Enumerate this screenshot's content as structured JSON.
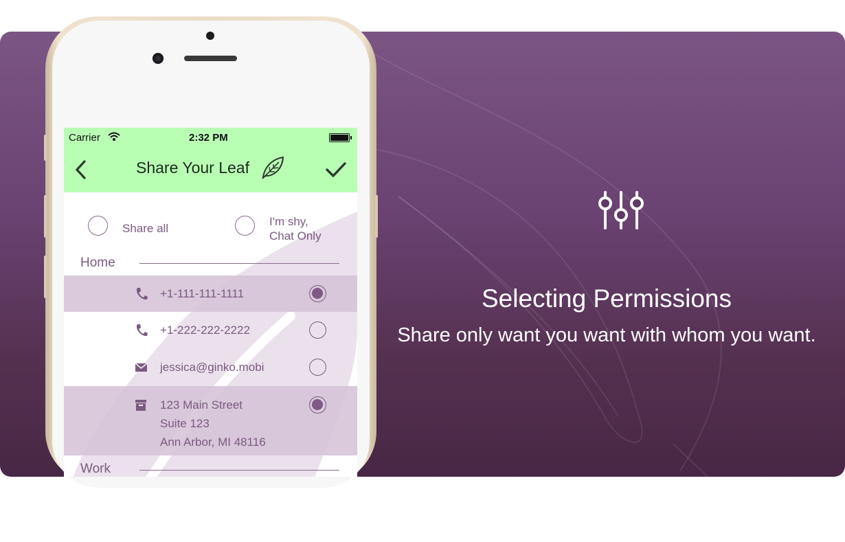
{
  "status_bar": {
    "carrier": "Carrier",
    "time": "2:32 PM"
  },
  "nav": {
    "title": "Share Your Leaf"
  },
  "options": {
    "share_all": "Share all",
    "shy_line1": "I'm shy,",
    "shy_line2": "Chat Only"
  },
  "sections": {
    "home": "Home",
    "work": "Work"
  },
  "contacts": [
    {
      "icon": "phone-icon",
      "text": "+1-111-111-1111",
      "selected": true
    },
    {
      "icon": "phone-icon",
      "text": "+1-222-222-2222",
      "selected": false
    },
    {
      "icon": "email-icon",
      "text": "jessica@ginko.mobi",
      "selected": false
    },
    {
      "icon": "address-icon",
      "line1": "123 Main Street",
      "line2": "Suite 123",
      "line3": "Ann Arbor, MI 48116",
      "selected": true
    }
  ],
  "feature": {
    "icon": "sliders-icon",
    "title": "Selecting Permissions",
    "subtitle": "Share only want you want with whom you want."
  },
  "colors": {
    "banner": "#6a4373",
    "navbar": "#b8ffb4",
    "accent": "#7a5a80",
    "phone_frame": "#e9dcc6"
  }
}
